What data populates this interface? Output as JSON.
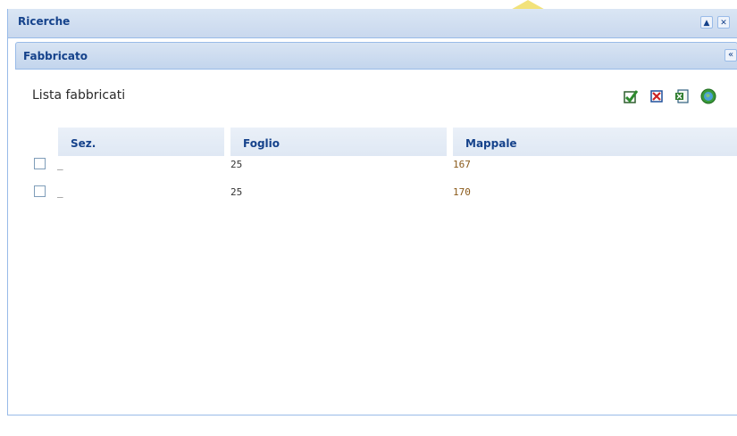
{
  "window": {
    "title": "Ricerche",
    "buttons": {
      "minimize": "▲",
      "close": "✕"
    }
  },
  "panel": {
    "title": "Fabbricato",
    "collapse_glyph": "«"
  },
  "list": {
    "title": "Lista fabbricati",
    "actions": [
      {
        "name": "select-all-icon",
        "color": "#2e8b2e"
      },
      {
        "name": "deselect-all-icon",
        "color": "#cc2222"
      },
      {
        "name": "export-excel-icon",
        "color": "#2f7d2f"
      },
      {
        "name": "locate-map-icon",
        "color": "#3a9a3a"
      }
    ]
  },
  "table": {
    "columns": [
      "Sez.",
      "Foglio",
      "Mappale"
    ],
    "rows": [
      {
        "sez": "_",
        "foglio": "25",
        "mappale": "167"
      },
      {
        "sez": "_",
        "foglio": "25",
        "mappale": "170"
      }
    ]
  },
  "colors": {
    "header_text": "#15428b",
    "border": "#99bbe8",
    "mappale_text": "#8a5a1a"
  }
}
